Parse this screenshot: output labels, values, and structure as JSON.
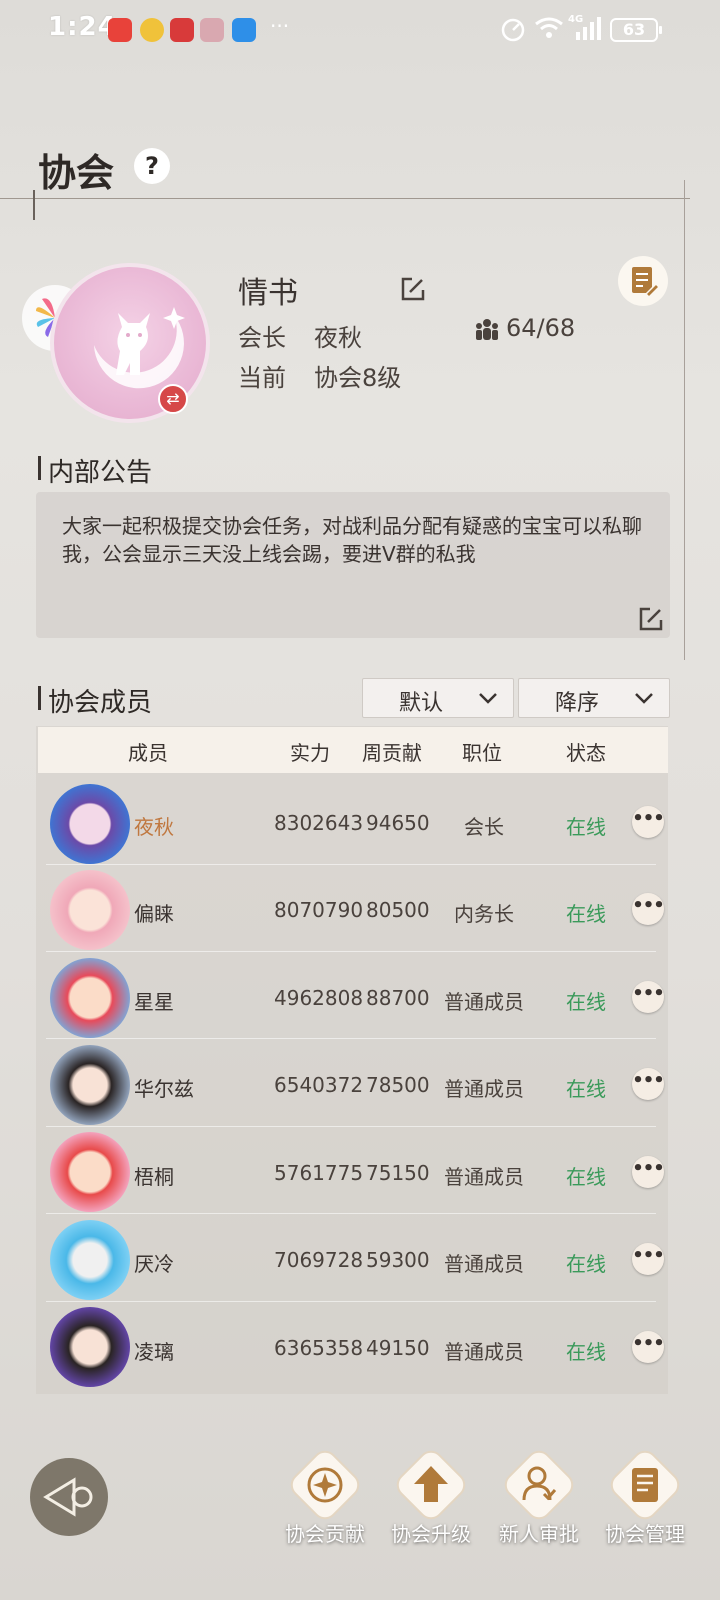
{
  "status_bar": {
    "time": "1:24",
    "battery": "63",
    "overflow": "···",
    "network": "4G"
  },
  "header": {
    "title": "协会",
    "help": "?"
  },
  "guild": {
    "name": "情书",
    "leader_label": "会长",
    "leader_name": "夜秋",
    "level_label": "当前",
    "level_value": "协会8级",
    "members_count": "64/68"
  },
  "announcement": {
    "title": "内部公告",
    "text": "大家一起积极提交协会任务，对战利品分配有疑惑的宝宝可以私聊我，公会显示三天没上线会踢，要进V群的私我"
  },
  "members_section": {
    "title": "协会成员",
    "sort_field": "默认",
    "sort_order": "降序",
    "columns": [
      "成员",
      "实力",
      "周贡献",
      "职位",
      "状态"
    ]
  },
  "members": [
    {
      "name": "夜秋",
      "power": "8302643",
      "weekly": "94650",
      "role": "会长",
      "status": "在线"
    },
    {
      "name": "偏睐",
      "power": "8070790",
      "weekly": "80500",
      "role": "内务长",
      "status": "在线"
    },
    {
      "name": "星星",
      "power": "4962808",
      "weekly": "88700",
      "role": "普通成员",
      "status": "在线"
    },
    {
      "name": "华尔兹",
      "power": "6540372",
      "weekly": "78500",
      "role": "普通成员",
      "status": "在线"
    },
    {
      "name": "梧桐",
      "power": "5761775",
      "weekly": "75150",
      "role": "普通成员",
      "status": "在线"
    },
    {
      "name": "厌冷",
      "power": "7069728",
      "weekly": "59300",
      "role": "普通成员",
      "status": "在线"
    },
    {
      "name": "凌璃",
      "power": "6365358",
      "weekly": "49150",
      "role": "普通成员",
      "status": "在线"
    }
  ],
  "bottom_actions": [
    {
      "label": "协会贡献",
      "icon": "contribution-icon"
    },
    {
      "label": "协会升级",
      "icon": "upgrade-arrow-icon"
    },
    {
      "label": "新人审批",
      "icon": "approval-person-icon"
    },
    {
      "label": "协会管理",
      "icon": "management-book-icon"
    }
  ],
  "colors": {
    "online": "#3a9a5a",
    "leader_name": "#c07840",
    "badge": "#d64848"
  }
}
